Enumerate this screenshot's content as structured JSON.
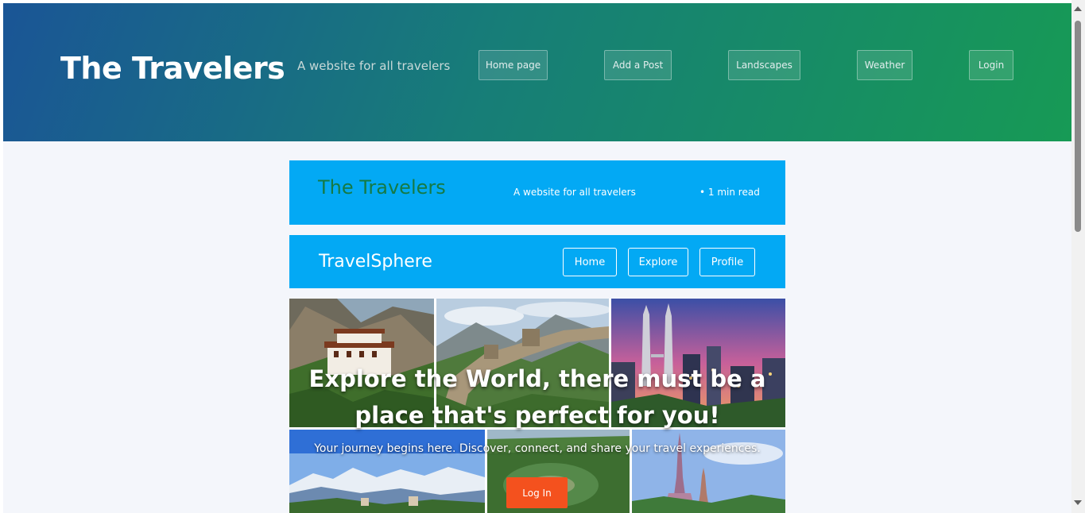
{
  "header": {
    "brand": "The Travelers",
    "tagline": "A website for all travelers",
    "nav": [
      {
        "label": "Home page"
      },
      {
        "label": "Add a Post"
      },
      {
        "label": "Landscapes"
      },
      {
        "label": "Weather"
      },
      {
        "label": "Login"
      }
    ],
    "gradient_colors": [
      "#1a5596",
      "#179a55"
    ]
  },
  "post_card": {
    "title": "The Travelers",
    "subtitle": "A website for all travelers",
    "read_time": "• 1 min read",
    "background": "#03a9f4"
  },
  "site_bar": {
    "name": "TravelSphere",
    "nav": [
      {
        "label": "Home"
      },
      {
        "label": "Explore"
      },
      {
        "label": "Profile"
      }
    ]
  },
  "hero": {
    "title": "Explore the World, there must be a place that's perfect for you!",
    "subtitle": "Your journey begins here. Discover, connect, and share your travel experiences.",
    "cta_label": "Log In",
    "cta_color": "#f4511e"
  }
}
